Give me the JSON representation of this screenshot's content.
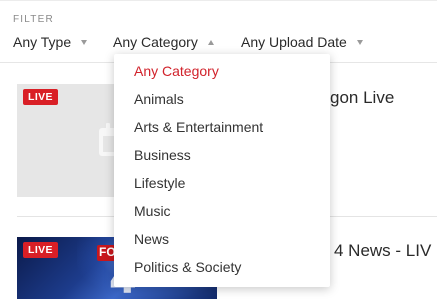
{
  "filter": {
    "label": "FILTER",
    "type_select": "Any Type",
    "category_select": "Any Category",
    "date_select": "Any Upload Date"
  },
  "dropdown": {
    "selected": "Any Category",
    "options": [
      "Any Category",
      "Animals",
      "Arts & Entertainment",
      "Business",
      "Lifestyle",
      "Music",
      "News",
      "Politics & Society"
    ]
  },
  "cards": [
    {
      "badge": "LIVE",
      "title_visible": "gon Live",
      "icon": "calendar-placeholder-icon"
    },
    {
      "badge": "LIVE",
      "title_visible": "4 News - LIV",
      "thumb_logo": "FO",
      "thumb_numeral": "4"
    }
  ],
  "colors": {
    "accent": "#d1222b",
    "live_badge": "#d91f26",
    "muted_text": "#8a8a8a"
  }
}
